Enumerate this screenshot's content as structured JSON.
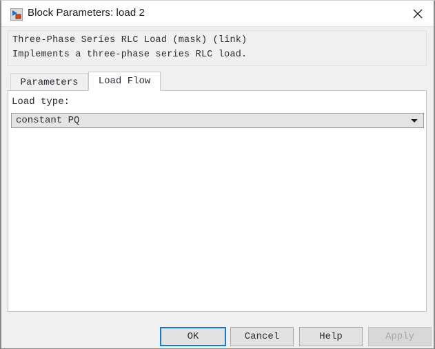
{
  "window": {
    "title": "Block Parameters: load 2",
    "icon": "simulink-block-icon",
    "close_label": "close-icon"
  },
  "description": {
    "line1": "Three-Phase Series RLC Load (mask) (link)",
    "line2": "Implements a three-phase series RLC load."
  },
  "tabs": [
    {
      "label": "Parameters",
      "active": false
    },
    {
      "label": "Load Flow",
      "active": true
    }
  ],
  "form": {
    "load_type": {
      "label": "Load type:",
      "value": "constant PQ",
      "arrow": "chevron-down-icon"
    }
  },
  "buttons": {
    "ok": "OK",
    "cancel": "Cancel",
    "help": "Help",
    "apply": "Apply"
  },
  "colors": {
    "accent": "#0c7cd5",
    "dialog_bg": "#f0f0f0",
    "panel_bg": "#ffffff",
    "field_bg": "#e4e4e4",
    "button_bg": "#e2e2e2",
    "disabled_text": "#a6a6a6",
    "text": "#2b2b33"
  }
}
